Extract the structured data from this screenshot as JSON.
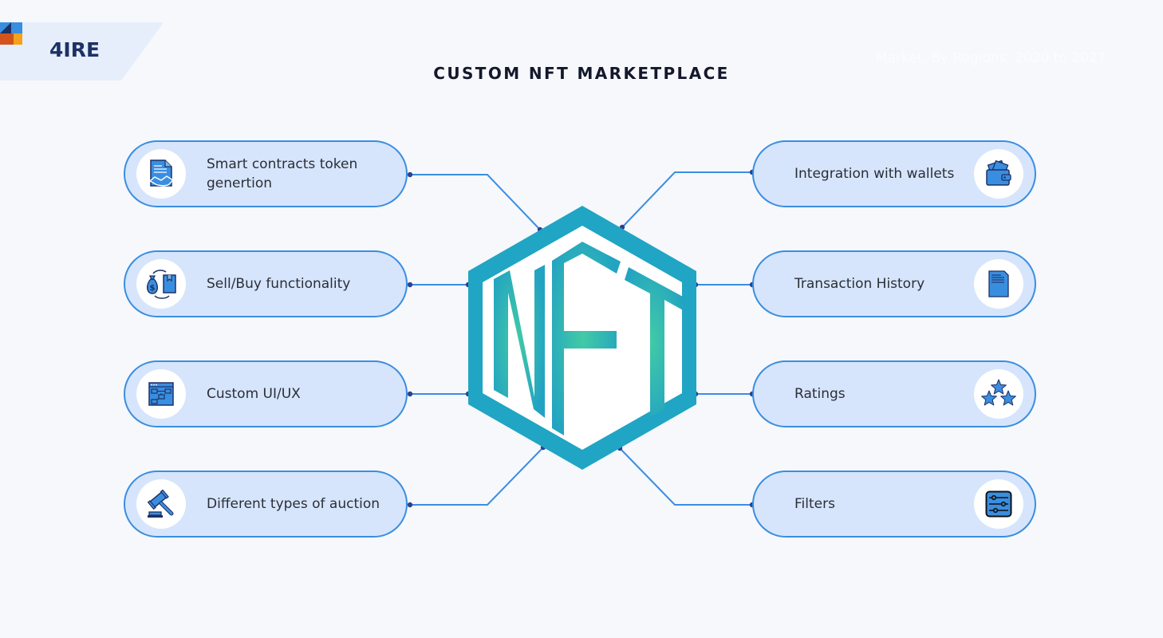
{
  "brand": {
    "logo_text": "4IRE",
    "colors": {
      "navy": "#1d3165",
      "blue": "#3a8ee0",
      "orange": "#d2541c",
      "amber": "#f5a11b",
      "banner": "#e6eefb"
    }
  },
  "title": "CUSTOM NFT MARKETPLACE",
  "ghost_text": "Market, By Regions, 2020 to 2027",
  "center": {
    "label": "NFT",
    "colors": {
      "hex": "#20a5c4",
      "letters_inner": "#40c9a8",
      "letters_outer": "#26a7c0"
    }
  },
  "features_left": [
    {
      "label": "Smart contracts token generation",
      "label_display": "Smart contracts token genertion",
      "icon": "contract-handshake-icon"
    },
    {
      "label": "Sell/Buy functionality",
      "label_display": "Sell/Buy functionality",
      "icon": "money-bag-exchange-icon"
    },
    {
      "label": "Custom UI/UX",
      "label_display": "Custom UI/UX",
      "icon": "flowchart-window-icon"
    },
    {
      "label": "Different types of auction",
      "label_display": "Different types of auction",
      "icon": "gavel-icon"
    }
  ],
  "features_right": [
    {
      "label": "Integration with wallets",
      "label_display": "Integration with wallets",
      "icon": "wallet-icon"
    },
    {
      "label": "Transaction History",
      "label_display": "Transaction History",
      "icon": "document-icon"
    },
    {
      "label": "Ratings",
      "label_display": "Ratings",
      "icon": "stars-icon"
    },
    {
      "label": "Filters",
      "label_display": "Filters",
      "icon": "sliders-icon"
    }
  ],
  "style_colors": {
    "pill_fill": "#d6e5fc",
    "pill_border": "#3a8ee0",
    "connector": "#3a8ee0",
    "node": "#2c4190",
    "text": "#2b2e38"
  }
}
